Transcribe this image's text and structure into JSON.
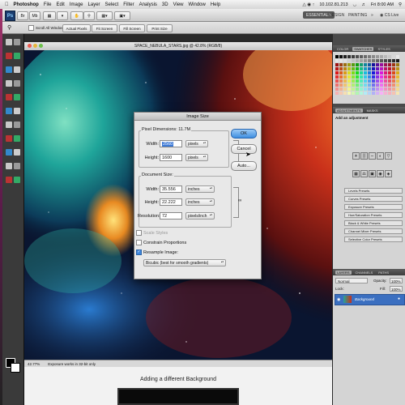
{
  "menubar": {
    "app": "Photoshop",
    "items": [
      "File",
      "Edit",
      "Image",
      "Layer",
      "Select",
      "Filter",
      "Analysis",
      "3D",
      "View",
      "Window",
      "Help"
    ],
    "ip": "10.102.81.213",
    "day_time": "Fri 8:00 AM"
  },
  "appbar": {
    "ps_logo": "Ps",
    "workspaces": [
      "ESSENTIALS",
      "DESIGN",
      "PAINTING"
    ],
    "cs_live": "CS Live"
  },
  "options": {
    "scroll_all": "Scroll All Windows",
    "actual_pixels": "Actual Pixels",
    "fit_screen": "Fit Screen",
    "fill_screen": "Fill Screen",
    "print_size": "Print Size"
  },
  "document": {
    "title": "SPACE_NEBULA_STARS.jpg @ 42.8% (RGB/8)",
    "zoom": "42.77%",
    "status": "Exposure works in 32-bit only"
  },
  "page_below": {
    "caption": "Adding a different Background"
  },
  "dialog": {
    "title": "Image Size",
    "pixel_dimensions_label": "Pixel Dimensions:",
    "pixel_dimensions_value": "11.7M",
    "width_label": "Width:",
    "height_label": "Height:",
    "pixel_width": "2560",
    "pixel_height": "1600",
    "pixel_unit": "pixels",
    "document_size_label": "Document Size:",
    "doc_width": "35.556",
    "doc_height": "22.222",
    "doc_unit": "inches",
    "resolution_label": "Resolution:",
    "resolution": "72",
    "resolution_unit": "pixels/inch",
    "scale_styles": "Scale Styles",
    "constrain": "Constrain Proportions",
    "resample": "Resample Image:",
    "resample_method": "Bicubic (best for smooth gradients)",
    "ok": "OK",
    "cancel": "Cancel",
    "auto": "Auto..."
  },
  "panels": {
    "color_tabs": [
      "COLOR",
      "SWATCHES",
      "STYLES"
    ],
    "adj_tabs": [
      "ADJUSTMENTS",
      "MASKS"
    ],
    "add_adjustment": "Add an adjustment",
    "presets": [
      "Levels Presets",
      "Curves Presets",
      "Exposure Presets",
      "Hue/Saturation Presets",
      "Black & White Presets",
      "Channel Mixer Presets",
      "Selective Color Presets"
    ],
    "layer_tabs": [
      "LAYERS",
      "CHANNELS",
      "PATHS"
    ],
    "blend_mode": "Normal",
    "opacity_label": "Opacity:",
    "opacity": "100%",
    "lock_label": "Lock:",
    "fill_label": "Fill:",
    "fill": "100%",
    "layer_name": "Background"
  },
  "colors": {
    "ok_button": "#3e8ee0",
    "selection": "#3b78d6",
    "nebula_red": "#c9301a",
    "nebula_teal": "#1fa59a",
    "panel_bg": "#4a4a4a"
  }
}
